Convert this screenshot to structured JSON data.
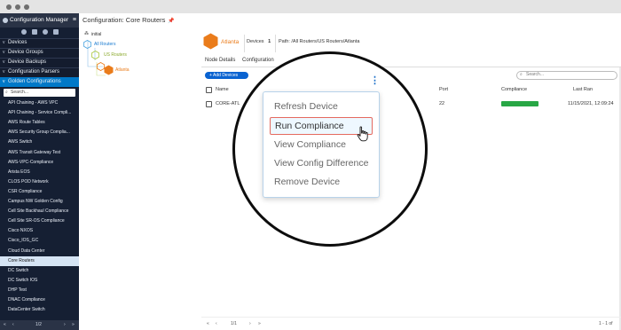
{
  "app": {
    "title": "Configuration Manager"
  },
  "sidebar": {
    "sections": [
      {
        "label": "Devices",
        "active": false
      },
      {
        "label": "Device Groups",
        "active": false
      },
      {
        "label": "Device Backups",
        "active": false
      },
      {
        "label": "Configuration Parsers",
        "active": false
      },
      {
        "label": "Golden Configurations",
        "active": true
      }
    ],
    "search_placeholder": "Search...",
    "golden_items": [
      "API Chaining - AWS VPC",
      "API Chaining - Service Compli...",
      "AWS Route Tables",
      "AWS Security Group Complia...",
      "AWS Switch",
      "AWS Transit Gateway Test",
      "AWS-VPC-Compliance",
      "Arista EOS",
      "CLOS POD Network",
      "CSR Compliance",
      "Campus NW Golden Config",
      "Cell Site Backhaul Compliance",
      "Cell Site SR-OS Compliance",
      "Cisco NXOS",
      "Cisco_IOS_GC",
      "Cloud Data Center",
      "Core Routers",
      "DC Switch",
      "DC Switch IOS",
      "DHP Test",
      "DNAC Compliance",
      "DataCenter Switch"
    ],
    "selected_item": "Core Routers",
    "pager": {
      "first": "«",
      "prev": "‹",
      "page": "1/2",
      "next": "›",
      "last": "»"
    }
  },
  "main": {
    "breadcrumb": "Configuration: Core Routers",
    "pin_icon": "pin-icon",
    "tree": {
      "root": "initial",
      "l1": "All Routers",
      "l2": "US Routers",
      "l3": "Atlanta"
    },
    "device": {
      "name": "Atlanta",
      "devices_label": "Devices",
      "devices_count": "1",
      "path": "Path: /All Routers/US Routers/Atlanta"
    },
    "tabs": [
      "Node Details",
      "Configuration"
    ],
    "toolbar": {
      "add_devices": "+ Add Devices",
      "search_placeholder": "Search..."
    },
    "table": {
      "headers": {
        "name": "Name",
        "port": "Port",
        "compliance": "Compliance",
        "last_ran": "Last Ran"
      },
      "rows": [
        {
          "name": "CORE-ATL",
          "port": "22",
          "compliance": 100,
          "last_ran": "11/15/2021, 12:09:24"
        }
      ]
    },
    "pager": {
      "first": "«",
      "prev": "‹",
      "page": "1/1",
      "next": "›",
      "last": "»",
      "count": "1 - 1 of"
    }
  },
  "menu": {
    "items": [
      "Refresh Device",
      "Run Compliance",
      "View Compliance",
      "View Config Difference",
      "Remove Device"
    ],
    "highlighted": "Run Compliance"
  },
  "colors": {
    "accent": "#0078c8",
    "sidebar_bg": "#151f33",
    "orange": "#ea7c1b",
    "lime": "#a8c63b",
    "blue_hex": "#4aa3df",
    "compliance_green": "#28a745",
    "highlight_border": "#e46a5f"
  }
}
